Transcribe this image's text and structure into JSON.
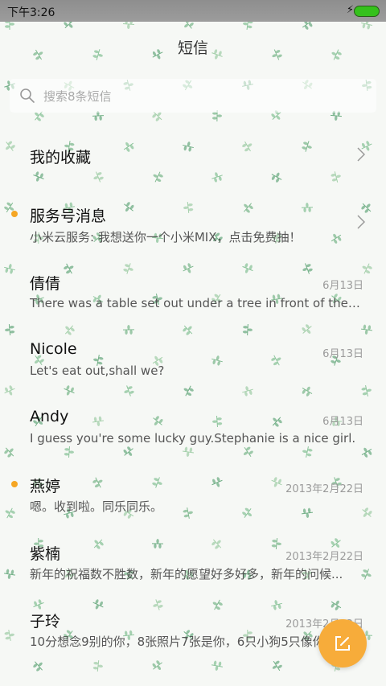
{
  "status_bar": {
    "time": "下午3:26",
    "charging_icon": "lightning-icon",
    "battery_icon": "battery-icon",
    "battery_color": "#35c11c"
  },
  "header": {
    "title": "短信"
  },
  "search": {
    "placeholder": "搜索8条短信",
    "icon": "search-icon"
  },
  "conversations": [
    {
      "name": "我的收藏",
      "preview": "",
      "date": "",
      "unread": false,
      "chevron": true
    },
    {
      "name": "服务号消息",
      "preview": "小米云服务: 我想送你一个小米MIX，点击免费抽！",
      "date": "",
      "unread": true,
      "chevron": true
    },
    {
      "name": "倩倩",
      "preview": "There was a table set out under a tree in front of the ho...",
      "date": "6月13日",
      "unread": false,
      "chevron": false
    },
    {
      "name": "Nicole",
      "preview": "Let's eat out,shall we?",
      "date": "6月13日",
      "unread": false,
      "chevron": false
    },
    {
      "name": "Andy",
      "preview": "I guess you're some lucky guy.Stephanie is a nice girl.",
      "date": "6月13日",
      "unread": false,
      "chevron": false
    },
    {
      "name": "燕婷",
      "preview": "嗯。收到啦。同乐同乐。",
      "date": "2013年2月22日",
      "unread": true,
      "chevron": false
    },
    {
      "name": "紫楠",
      "preview": "新年的祝福数不胜数，新年的愿望好多好多，新年的问候...",
      "date": "2013年2月22日",
      "unread": false,
      "chevron": false
    },
    {
      "name": "子玲",
      "preview": "10分想念9别的你，8张照片7张是你，6只小狗5只像你...",
      "date": "2013年2月22日",
      "unread": false,
      "chevron": false
    }
  ],
  "fab": {
    "icon": "compose-icon",
    "color": "#f7ac3a"
  },
  "theme": {
    "unread_dot_color": "#f5a623"
  }
}
